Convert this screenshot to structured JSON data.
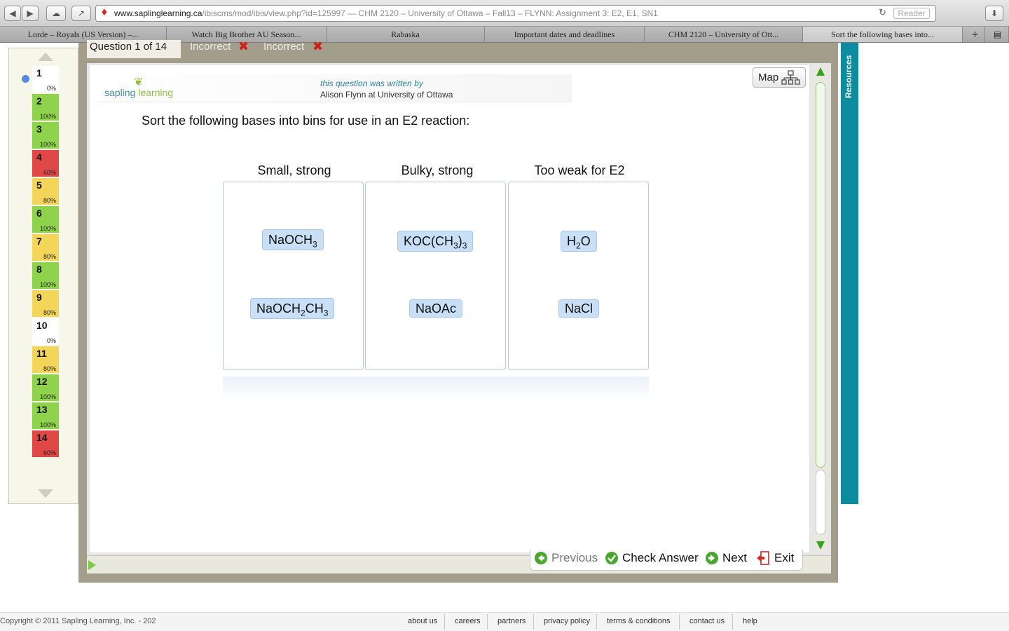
{
  "browser": {
    "url_domain": "www.saplinglearning.ca",
    "url_path": "/ibiscms/mod/ibis/view.php?id=125997",
    "page_title_suffix": " — CHM 2120 – University of Ottawa – Fall13 – FLYNN: Assignment 3: E2, E1, SN1",
    "reader_label": "Reader",
    "reload_glyph": "↻",
    "tabs": [
      {
        "label": "Lorde – Royals (US Version) –..."
      },
      {
        "label": "Watch Big Brother AU Season..."
      },
      {
        "label": "Rabaska"
      },
      {
        "label": "Important dates and deadlines"
      },
      {
        "label": "CHM 2120 – University of Ott..."
      },
      {
        "label": "Sort the following bases into..."
      }
    ],
    "new_tab_glyph": "+",
    "tabs_overview_glyph": "▤"
  },
  "qnav": {
    "items": [
      {
        "num": "1",
        "pct": "0%",
        "status": "white"
      },
      {
        "num": "2",
        "pct": "100%",
        "status": "green"
      },
      {
        "num": "3",
        "pct": "100%",
        "status": "green"
      },
      {
        "num": "4",
        "pct": "60%",
        "status": "red"
      },
      {
        "num": "5",
        "pct": "80%",
        "status": "yellow"
      },
      {
        "num": "6",
        "pct": "100%",
        "status": "green"
      },
      {
        "num": "7",
        "pct": "80%",
        "status": "yellow"
      },
      {
        "num": "8",
        "pct": "100%",
        "status": "green"
      },
      {
        "num": "9",
        "pct": "80%",
        "status": "yellow"
      },
      {
        "num": "10",
        "pct": "0%",
        "status": "white"
      },
      {
        "num": "11",
        "pct": "80%",
        "status": "yellow"
      },
      {
        "num": "12",
        "pct": "100%",
        "status": "green"
      },
      {
        "num": "13",
        "pct": "100%",
        "status": "green"
      },
      {
        "num": "14",
        "pct": "60%",
        "status": "red"
      }
    ]
  },
  "question_header": {
    "label": "Question 1 of 14",
    "attempts": [
      "Incorrect",
      "Incorrect"
    ],
    "x_glyph": "✖"
  },
  "branding": {
    "logo_part1": "sapling ",
    "logo_part2": "learning",
    "written_by": "this question was written by",
    "author": "Alison Flynn at University of Ottawa"
  },
  "map_label": "Map",
  "question_text": "Sort the following bases into bins for use in an E2 reaction:",
  "bins": [
    {
      "title": "Small, strong"
    },
    {
      "title": "Bulky, strong"
    },
    {
      "title": "Too weak for E2"
    }
  ],
  "chips": {
    "naoch3": {
      "main": "NaOCH",
      "sub": "3"
    },
    "naoch2ch3": {
      "a": "NaOCH",
      "sub1": "2",
      "b": "CH",
      "sub2": "3"
    },
    "kocch3": {
      "a": "KOC(CH",
      "sub1": "3",
      "b": ")",
      "sub2": "3"
    },
    "naoac": {
      "main": "NaOAc"
    },
    "h2o": {
      "a": "H",
      "sub": "2",
      "b": "O"
    },
    "nacl": {
      "main": "NaCl"
    }
  },
  "resources_label": "Resources",
  "actions": {
    "previous": "Previous",
    "check_answer": "Check Answer",
    "next": "Next",
    "exit": "Exit"
  },
  "footer": {
    "copyright": "Copyright © 2011 Sapling Learning, Inc. - 202",
    "links": [
      "about us",
      "careers",
      "partners",
      "privacy policy",
      "terms & conditions",
      "contact us",
      "help"
    ]
  },
  "colors": {
    "accent_teal": "#0d8ca0",
    "green": "#8ed34b",
    "red": "#e04848",
    "yellow": "#f3d55a"
  }
}
